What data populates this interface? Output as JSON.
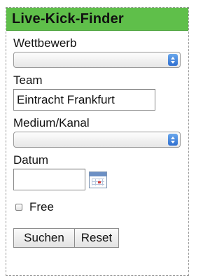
{
  "widget": {
    "title": "Live-Kick-Finder",
    "header_color": "#5fbf4a"
  },
  "fields": {
    "competition_label": "Wettbewerb",
    "competition_value": "",
    "team_label": "Team",
    "team_value": "Eintracht Frankfurt",
    "medium_label": "Medium/Kanal",
    "medium_value": "",
    "date_label": "Datum",
    "date_value": "",
    "free_label": "Free",
    "free_checked": false
  },
  "buttons": {
    "search_label": "Suchen",
    "reset_label": "Reset"
  },
  "icons": {
    "select_arrow": "select-arrow-icon",
    "calendar": "calendar-icon"
  },
  "colors": {
    "select_arrow": "#2f6fd0",
    "calendar_accent": "#6b8fc4"
  }
}
